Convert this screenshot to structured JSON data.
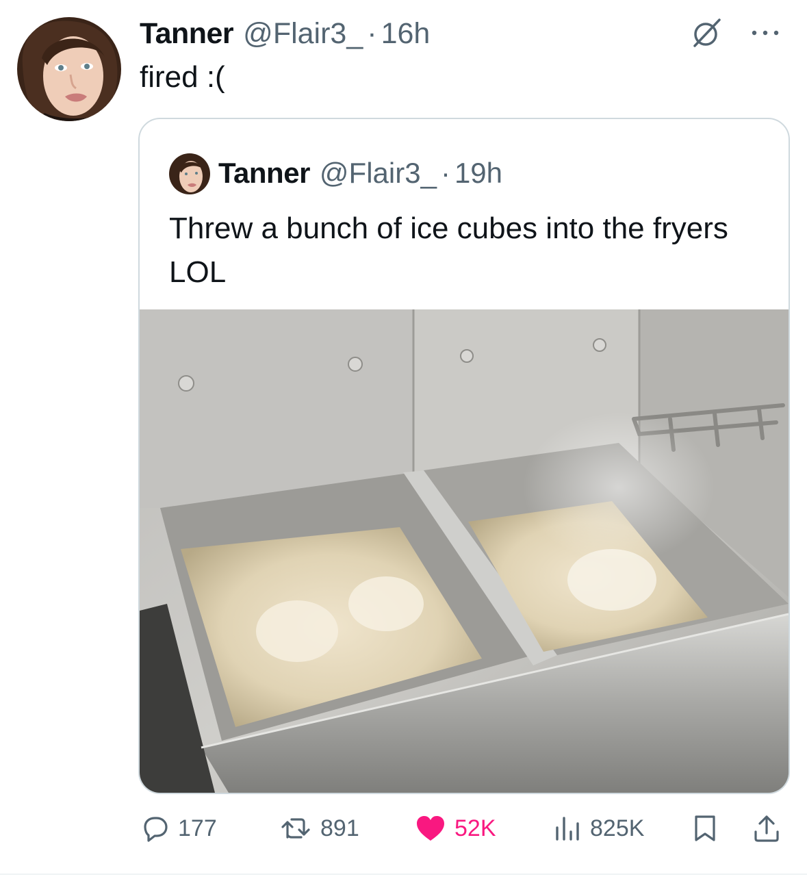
{
  "tweet": {
    "display_name": "Tanner",
    "handle": "@Flair3_",
    "separator": "·",
    "time": "16h",
    "text": "fired :("
  },
  "quoted_tweet": {
    "display_name": "Tanner",
    "handle": "@Flair3_",
    "separator": "·",
    "time": "19h",
    "text": "Threw a bunch of ice cubes into the fryers LOL"
  },
  "actions": {
    "replies": "177",
    "reposts": "891",
    "likes": "52K",
    "views": "825K"
  },
  "colors": {
    "text_primary": "#0f1419",
    "text_secondary": "#536471",
    "like_active": "#f91880",
    "card_border": "#cfd9de"
  },
  "icons": {
    "grok": "grok-icon",
    "more": "more-dots-icon",
    "reply": "reply-bubble-icon",
    "repost": "repost-icon",
    "like": "heart-filled-icon",
    "views": "views-bar-chart-icon",
    "bookmark": "bookmark-icon",
    "share": "share-upload-icon"
  }
}
